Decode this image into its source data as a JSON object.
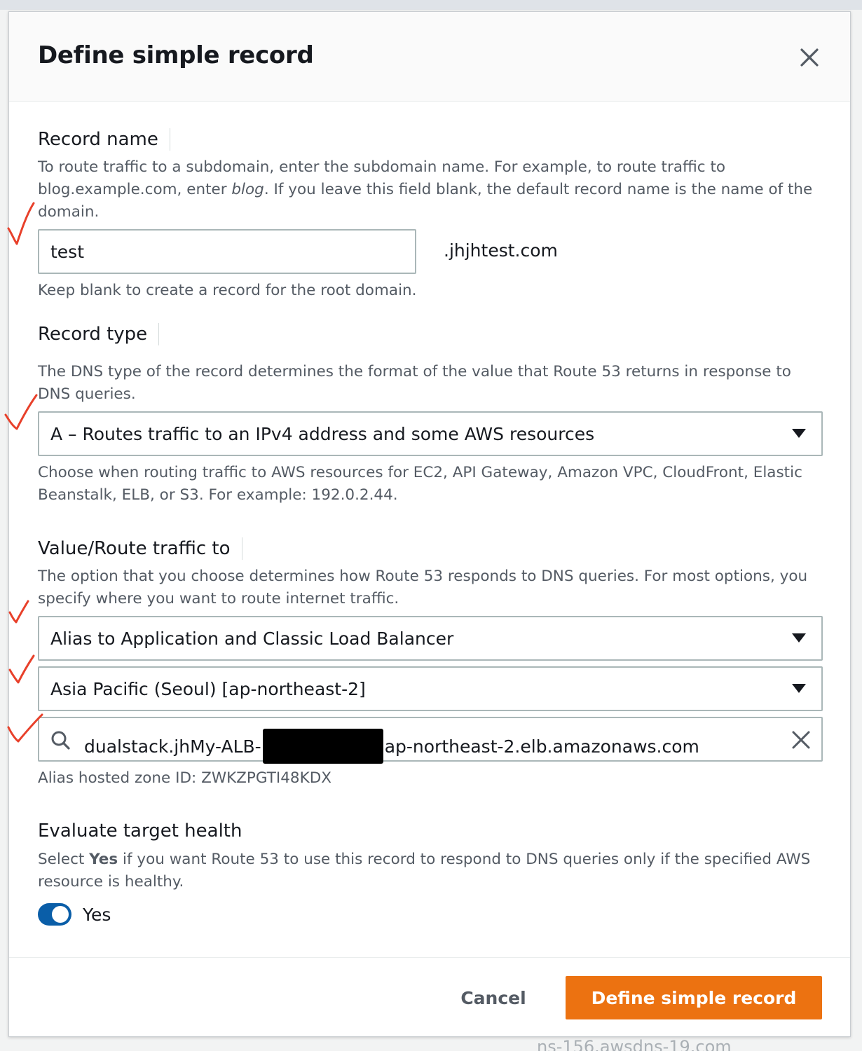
{
  "dialog": {
    "title": "Define simple record"
  },
  "record_name": {
    "label": "Record name",
    "description_before": "To route traffic to a subdomain, enter the subdomain name. For example, to route traffic to blog.example.com, enter ",
    "description_em": "blog",
    "description_after": ". If you leave this field blank, the default record name is the name of the domain.",
    "value": "test",
    "domain_suffix": ".jhjhtest.com",
    "hint": "Keep blank to create a record for the root domain."
  },
  "record_type": {
    "label": "Record type",
    "description": "The DNS type of the record determines the format of the value that Route 53 returns in response to DNS queries.",
    "selected": "A – Routes traffic to an IPv4 address and some AWS resources",
    "hint": "Choose when routing traffic to AWS resources for EC2, API Gateway, Amazon VPC, CloudFront, Elastic Beanstalk, ELB, or S3. For example: 192.0.2.44."
  },
  "route_traffic": {
    "label": "Value/Route traffic to",
    "description": "The option that you choose determines how Route 53 responds to DNS queries. For most options, you specify where you want to route internet traffic.",
    "endpoint_selected": "Alias to Application and Classic Load Balancer",
    "region_selected": "Asia Pacific (Seoul) [ap-northeast-2]",
    "lb_value_prefix": "dualstack.jhMy-ALB-",
    "lb_value_suffix": "ap-northeast-2.elb.amazonaws.com",
    "hosted_zone": "Alias hosted zone ID: ZWKZPGTI48KDX"
  },
  "evaluate_health": {
    "label": "Evaluate target health",
    "description_before": "Select ",
    "description_bold": "Yes",
    "description_after": " if you want Route 53 to use this record to respond to DNS queries only if the specified AWS resource is healthy.",
    "toggle_on": true,
    "toggle_label": "Yes"
  },
  "footer": {
    "cancel_label": "Cancel",
    "primary_label": "Define simple record"
  },
  "background": {
    "bottom_text": "ns-156.awsdns-19.com"
  },
  "colors": {
    "primary": "#ec7211",
    "toggle": "#0a5ea8",
    "annotation": "#e8402a"
  },
  "icons": {
    "close": "close-icon",
    "dropdown": "caret-down-icon",
    "search": "search-icon",
    "clear": "clear-icon",
    "annotation": "checkmark-annotation"
  }
}
